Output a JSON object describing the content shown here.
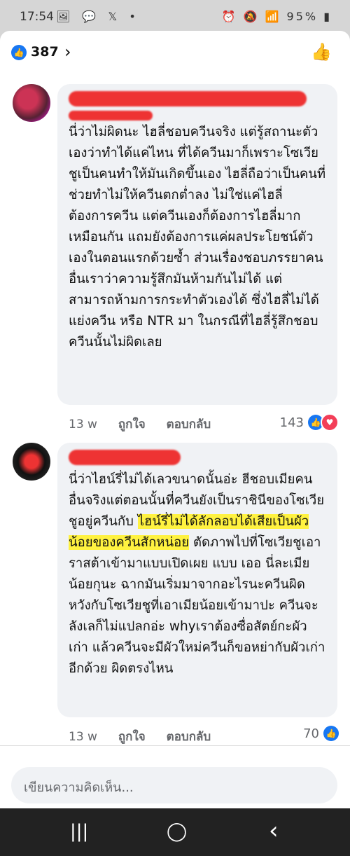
{
  "status": {
    "time": "17:54",
    "left_icons": "🖼 💬 𝕏 •",
    "right": "⏰ 🔕 📶 95% ▮"
  },
  "header": {
    "reaction_count": "387"
  },
  "comments": [
    {
      "body": "นี่ว่าไม่ผิดนะ ไฮลี่ชอบควีนจริง แต่รู้สถานะตัวเองว่าทำได้แค่ไหน ที่ได้ควีนมาก็เพราะโซเวียชูเป็นคนทำให้มันเกิดขึ้นเอง ไฮลี่ถือว่าเป็นคนที่ช่วยทำไม่ให้ควีนตกต่ำลง ไม่ใช่แค่ไฮลี่ต้องการควีน แต่ควีนเองก็ต้องการไฮลี่มากเหมือนกัน แถมยังต้องการแค่ผลประโยชน์ตัวเองในตอนแรกด้วยซ้ำ ส่วนเรื่องชอบภรรยาคนอื่นเราว่าความรู้สึกมันห้ามกันไม่ได้ แต่สามารถห้ามการกระทำตัวเองได้ ซึ่งไฮลี่ไม่ได้แย่งควีน หรือ NTR มา ในกรณีที่ไฮลี่รู้สึกชอบควีนนั้นไม่ผิดเลย",
      "time": "13 w",
      "like": "ถูกใจ",
      "reply": "ตอบกลับ",
      "reactions": "143"
    },
    {
      "body_a": "นี่ว่าไฮน์รี่ไม่ได้เลวขนาดนั้นอ่ะ ฮีชอบเมียคนอื่นจริงแต่ตอนนั้นที่ควีนยังเป็นราชินีของโซเวียชูอยู่ควีนกับ ",
      "body_hl": "ไฮน์รี่ไม่ได้ลักลอบได้เสียเป็นผัวน้อยของควีนสักหน่อย",
      "body_b": " ตัดภาพไปที่โซเวียชูเอาราสต้าเข้ามาแบบเปิดเผย แบบ เออ นี่ละเมียน้อยกุนะ ฉากมันเริ่มมาจากอะไรนะควีนผิดหวังกับโซเวียชูที่เอาเมียน้อยเข้ามาปะ ควีนจะลังเลก็ไม่แปลกอ่ะ whyเราต้องซื่อสัตย์กะผัวเก่า แล้วควีนจะมีผัวใหม่ควีนก็ขอหย่ากับผัวเก่าอีกด้วย ผิดตรงไหน",
      "time": "13 w",
      "like": "ถูกใจ",
      "reply": "ตอบกลับ",
      "reactions": "70"
    }
  ],
  "composer": {
    "placeholder": "เขียนความคิดเห็น..."
  },
  "nav": {
    "recent": "|||",
    "home": "◯",
    "back": "‹"
  }
}
